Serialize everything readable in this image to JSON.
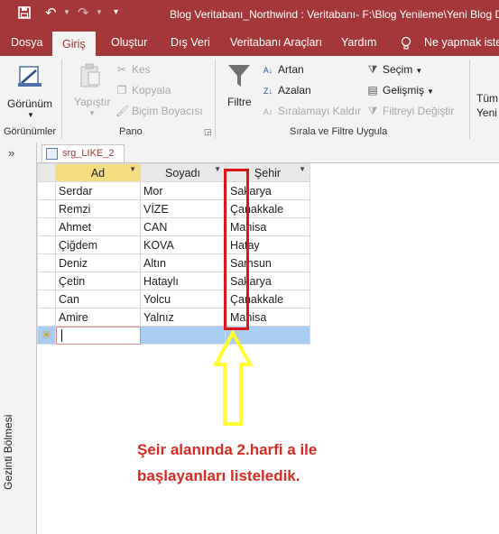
{
  "titlebar": {
    "title": "Blog Veritabanı_Northwind : Veritabanı- F:\\Blog Yenileme\\Yeni Blog D",
    "icons": [
      "save-icon",
      "undo-icon",
      "redo-icon",
      "customize-icon"
    ],
    "bg": "#a4373a"
  },
  "menu": {
    "tabs": [
      "Dosya",
      "Giriş",
      "Oluştur",
      "Dış Veri",
      "Veritabanı Araçları",
      "Yardım"
    ],
    "active": "Giriş",
    "help": "Ne yapmak iste"
  },
  "ribbon": {
    "views": {
      "label": "Görünüm",
      "group": "Görünümler"
    },
    "clipboard": {
      "paste": "Yapıştır",
      "cut": "Kes",
      "copy": "Kopyala",
      "format_painter": "Biçim Boyacısı",
      "group": "Pano"
    },
    "sort_filter": {
      "filter": "Filtre",
      "ascending": "Artan",
      "descending": "Azalan",
      "remove_sort": "Sıralamayı Kaldır",
      "selection": "Seçim",
      "advanced": "Gelişmiş",
      "toggle_filter": "Filtreyi Değiştir",
      "group": "Sırala ve Filtre Uygula"
    },
    "records": {
      "all_label_1": "Tüm",
      "all_label_2": "Yeni"
    }
  },
  "nav_pane": {
    "label": "Gezinti Bölmesi",
    "chevron": "»"
  },
  "document_tab": {
    "label": "srg_LIKE_2"
  },
  "grid": {
    "columns": [
      "Ad",
      "Soyadı",
      "Şehir"
    ],
    "rows": [
      [
        "Serdar",
        "Mor",
        "Sakarya"
      ],
      [
        "Remzi",
        "VİZE",
        "Çanakkale"
      ],
      [
        "Ahmet",
        "CAN",
        "Manisa"
      ],
      [
        "Çiğdem",
        "KOVA",
        "Hatay"
      ],
      [
        "Deniz",
        "Altın",
        "Samsun"
      ],
      [
        "Çetin",
        "Hataylı",
        "Sakarya"
      ],
      [
        "Can",
        "Yolcu",
        "Çanakkale"
      ],
      [
        "Amire",
        "Yalnız",
        "Manisa"
      ]
    ],
    "new_row_marker": "✳"
  },
  "annotation": {
    "line1": "Şeir alanında 2.harfi a ile",
    "line2": "başlayanları listeledik.",
    "color": "#d62b22",
    "box_color": "#e01515",
    "arrow_color": "#ffff33"
  }
}
